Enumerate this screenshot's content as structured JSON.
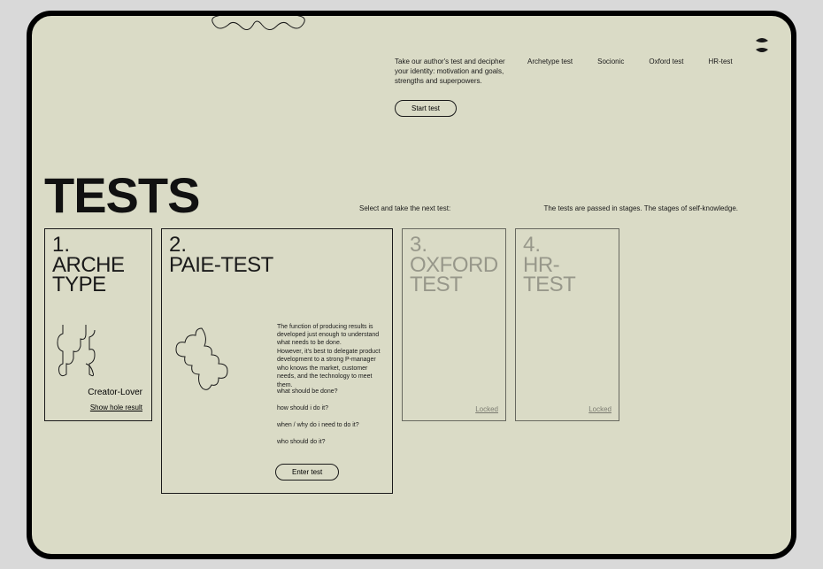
{
  "header": {
    "intro": "Take our author's test and decipher your identity: motivation and goals, strengths and superpowers.",
    "nav": {
      "archetype": "Archetype test",
      "socionic": "Socionic",
      "oxford": "Oxford test",
      "hr": "HR-test"
    },
    "start_label": "Start test"
  },
  "page": {
    "title": "TESTS",
    "select_hint": "Select and take the next test:",
    "stages_hint": "The tests are passed in stages. The stages of self-knowledge."
  },
  "cards": {
    "c1": {
      "num": "1.",
      "title_l1": "ARCHE",
      "title_l2": "TYPE",
      "result": "Creator-Lover",
      "hole": "Show hole result"
    },
    "c2": {
      "num": "2.",
      "title": "PAIE-TEST",
      "desc": "The function of producing results is developed just enough to understand what needs to be done.\nHowever, it's best to delegate product development to a strong P-manager who knows the market, customer needs, and the technology to meet them.",
      "q1": "what should be done?",
      "q2": "how should i do it?",
      "q3": "when / why do i need to do it?",
      "q4": "who should do it?",
      "enter": "Enter test"
    },
    "c3": {
      "num": "3.",
      "title_l1": "OXFORD",
      "title_l2": "TEST",
      "locked": "Locked"
    },
    "c4": {
      "num": "4.",
      "title": "HR-TEST",
      "locked": "Locked"
    }
  }
}
